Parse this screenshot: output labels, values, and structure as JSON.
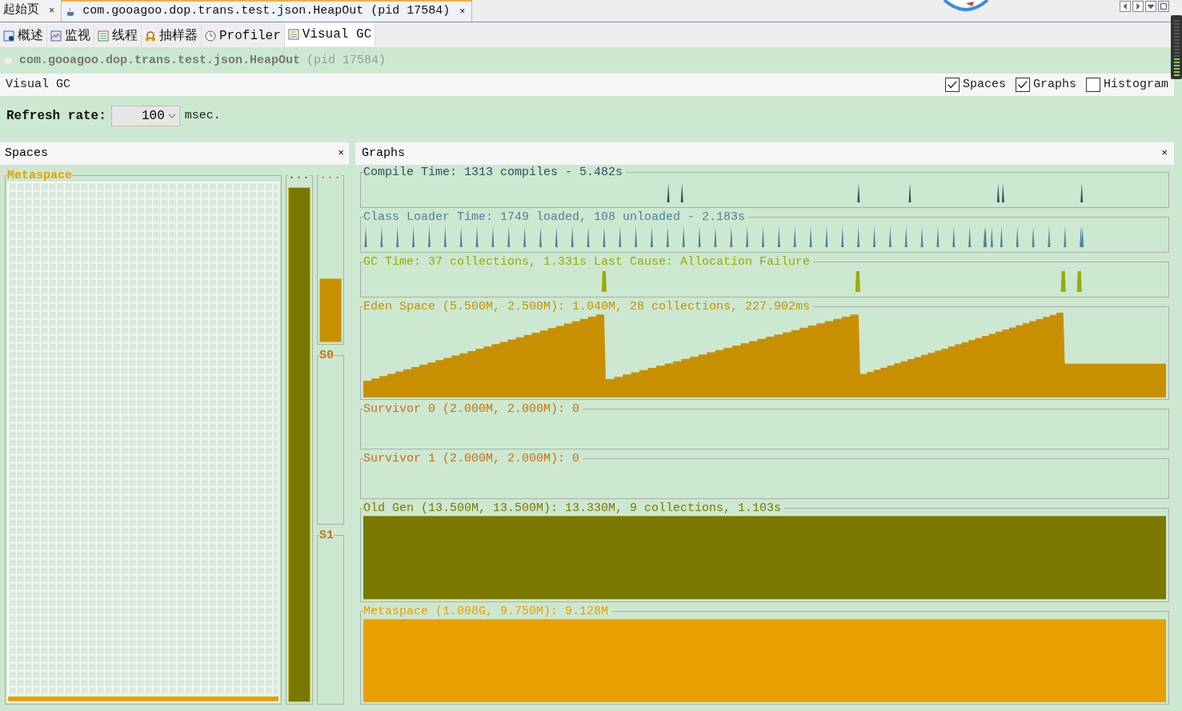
{
  "doc_tabs": [
    {
      "label": "起始页",
      "close": "×",
      "selected": false
    },
    {
      "label": "com.gooagoo.dop.trans.test.json.HeapOut (pid 17584)",
      "close": "×",
      "selected": true
    }
  ],
  "view_tabs": [
    {
      "label": "概述",
      "selected": false
    },
    {
      "label": "监视",
      "selected": false
    },
    {
      "label": "线程",
      "selected": false
    },
    {
      "label": "抽样器",
      "selected": false
    },
    {
      "label": "Profiler",
      "selected": false
    },
    {
      "label": "Visual GC",
      "selected": true
    }
  ],
  "process_title": {
    "name": "com.gooagoo.dop.trans.test.json.HeapOut",
    "pid": "(pid 17584)"
  },
  "toolbar": {
    "title": "Visual GC",
    "options": [
      {
        "label": "Spaces",
        "checked": true
      },
      {
        "label": "Graphs",
        "checked": true
      },
      {
        "label": "Histogram",
        "checked": false
      }
    ]
  },
  "refresh": {
    "label": "Refresh rate:",
    "value": "100",
    "unit": "msec."
  },
  "spaces": {
    "title": "Spaces",
    "close": "×",
    "metaspace": {
      "label": "Metaspace",
      "level": 0.01
    },
    "old": {
      "label": "...",
      "level": 0.99
    },
    "eden": {
      "label": "...",
      "level": 0.4
    },
    "survivors": [
      {
        "label": "S0"
      },
      {
        "label": "S1"
      }
    ]
  },
  "graphs": {
    "title": "Graphs",
    "close": "×",
    "items": [
      {
        "kind": "spikes",
        "title": "Compile Time: 1313 compiles - 5.482s",
        "color": "#2f4f5f"
      },
      {
        "kind": "dense",
        "title": "Class Loader Time: 1749 loaded, 108 unloaded - 2.183s",
        "color": "#4f7f9f"
      },
      {
        "kind": "gc",
        "title": "GC Time: 37 collections, 1.331s  Last Cause: Allocation Failure",
        "color": "#9aaa00"
      },
      {
        "kind": "sawtooth",
        "title": "Eden Space (5.500M, 2.500M): 1.040M, 28 collections, 227.902ms",
        "color": "#c89000"
      },
      {
        "kind": "empty",
        "title": "Survivor 0 (2.000M, 2.000M): 0",
        "color": "#c87010"
      },
      {
        "kind": "empty",
        "title": "Survivor 1 (2.000M, 2.000M): 0",
        "color": "#c87010"
      },
      {
        "kind": "fill",
        "title": "Old Gen (13.500M, 13.500M): 13.330M, 9 collections, 1.103s",
        "color": "#7a7800"
      },
      {
        "kind": "fill",
        "title": "Metaspace (1.008G, 9.750M): 9.128M",
        "color": "#e8a000"
      }
    ]
  }
}
